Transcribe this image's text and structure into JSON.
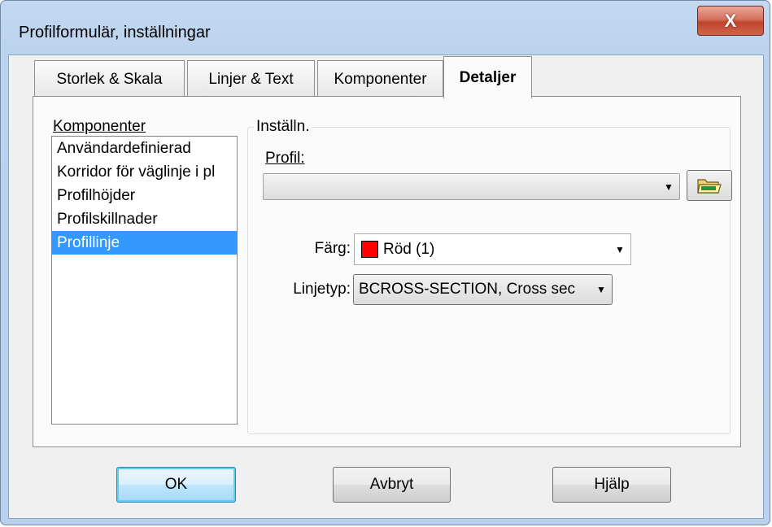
{
  "window": {
    "title": "Profilformulär, inställningar",
    "close_label": "X"
  },
  "tabs": [
    {
      "label": "Storlek & Skala",
      "active": false
    },
    {
      "label": "Linjer & Text",
      "active": false
    },
    {
      "label": "Komponenter",
      "active": false
    },
    {
      "label": "Detaljer",
      "active": true
    }
  ],
  "components": {
    "label": "Komponenter",
    "items": [
      "Användardefinierad",
      "Korridor för väglinje i pl",
      "Profilhöjder",
      "Profilskillnader",
      "Profillinje"
    ],
    "selected": "Profillinje"
  },
  "settings": {
    "group_title": "Inställn.",
    "profil_label": "Profil:",
    "profil_value": "",
    "color_label": "Färg:",
    "color_value": "Röd (1)",
    "color_swatch": "#ff0000",
    "linetype_label": "Linjetyp:",
    "linetype_value": "BCROSS-SECTION, Cross sec"
  },
  "buttons": {
    "ok": "OK",
    "cancel": "Avbryt",
    "help": "Hjälp"
  },
  "icons": {
    "folder": "folder-open-icon",
    "dropdown": "chevron-down-icon"
  },
  "colors": {
    "selection": "#3399ff",
    "accent": "#3c7fb1"
  }
}
